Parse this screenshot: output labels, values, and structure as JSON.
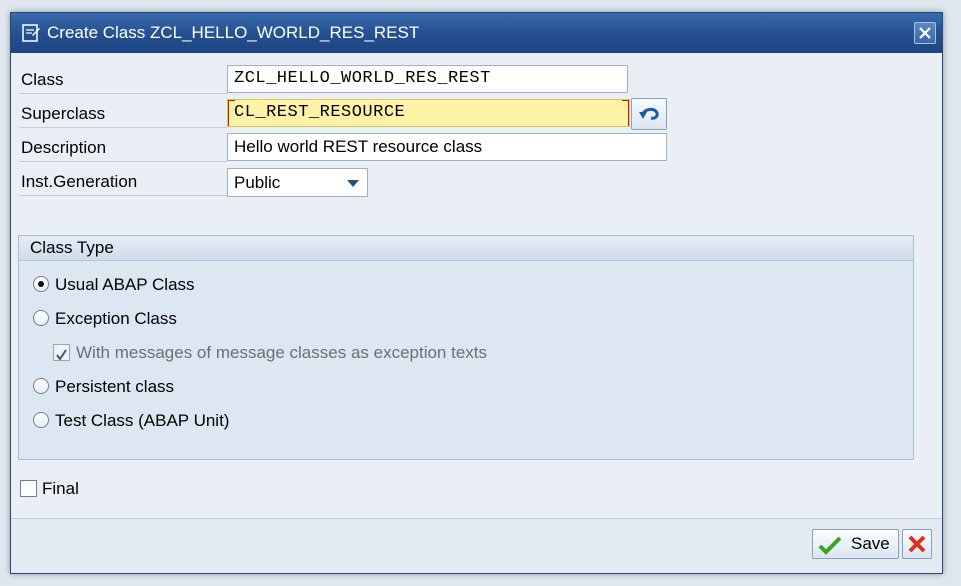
{
  "dialog": {
    "title": "Create Class ZCL_HELLO_WORLD_RES_REST",
    "icons": {
      "title": "create-class-icon",
      "close": "close-icon"
    }
  },
  "fields": {
    "class": {
      "label": "Class",
      "value": "ZCL_HELLO_WORLD_RES_REST"
    },
    "superclass": {
      "label": "Superclass",
      "value": "CL_REST_RESOURCE",
      "history_icon": "undo-icon"
    },
    "description": {
      "label": "Description",
      "value": "Hello world REST resource class"
    },
    "inst_generation": {
      "label": "Inst.Generation",
      "selected": "Public"
    }
  },
  "class_type": {
    "header": "Class Type",
    "options": {
      "usual": "Usual ABAP Class",
      "exception": "Exception Class",
      "messages": "With messages of message classes as exception texts",
      "persistent": "Persistent class",
      "test": "Test Class (ABAP Unit)"
    },
    "selected": "usual"
  },
  "final": {
    "label": "Final"
  },
  "buttons": {
    "save": "Save",
    "save_icon": "checkmark-icon",
    "cancel_icon": "cancel-icon"
  },
  "colors": {
    "titlebar": "#244f8f",
    "required_bg": "#fef2a7",
    "required_bracket": "#d21414",
    "save_check": "#3aa31d",
    "cancel_x": "#d8331c"
  }
}
